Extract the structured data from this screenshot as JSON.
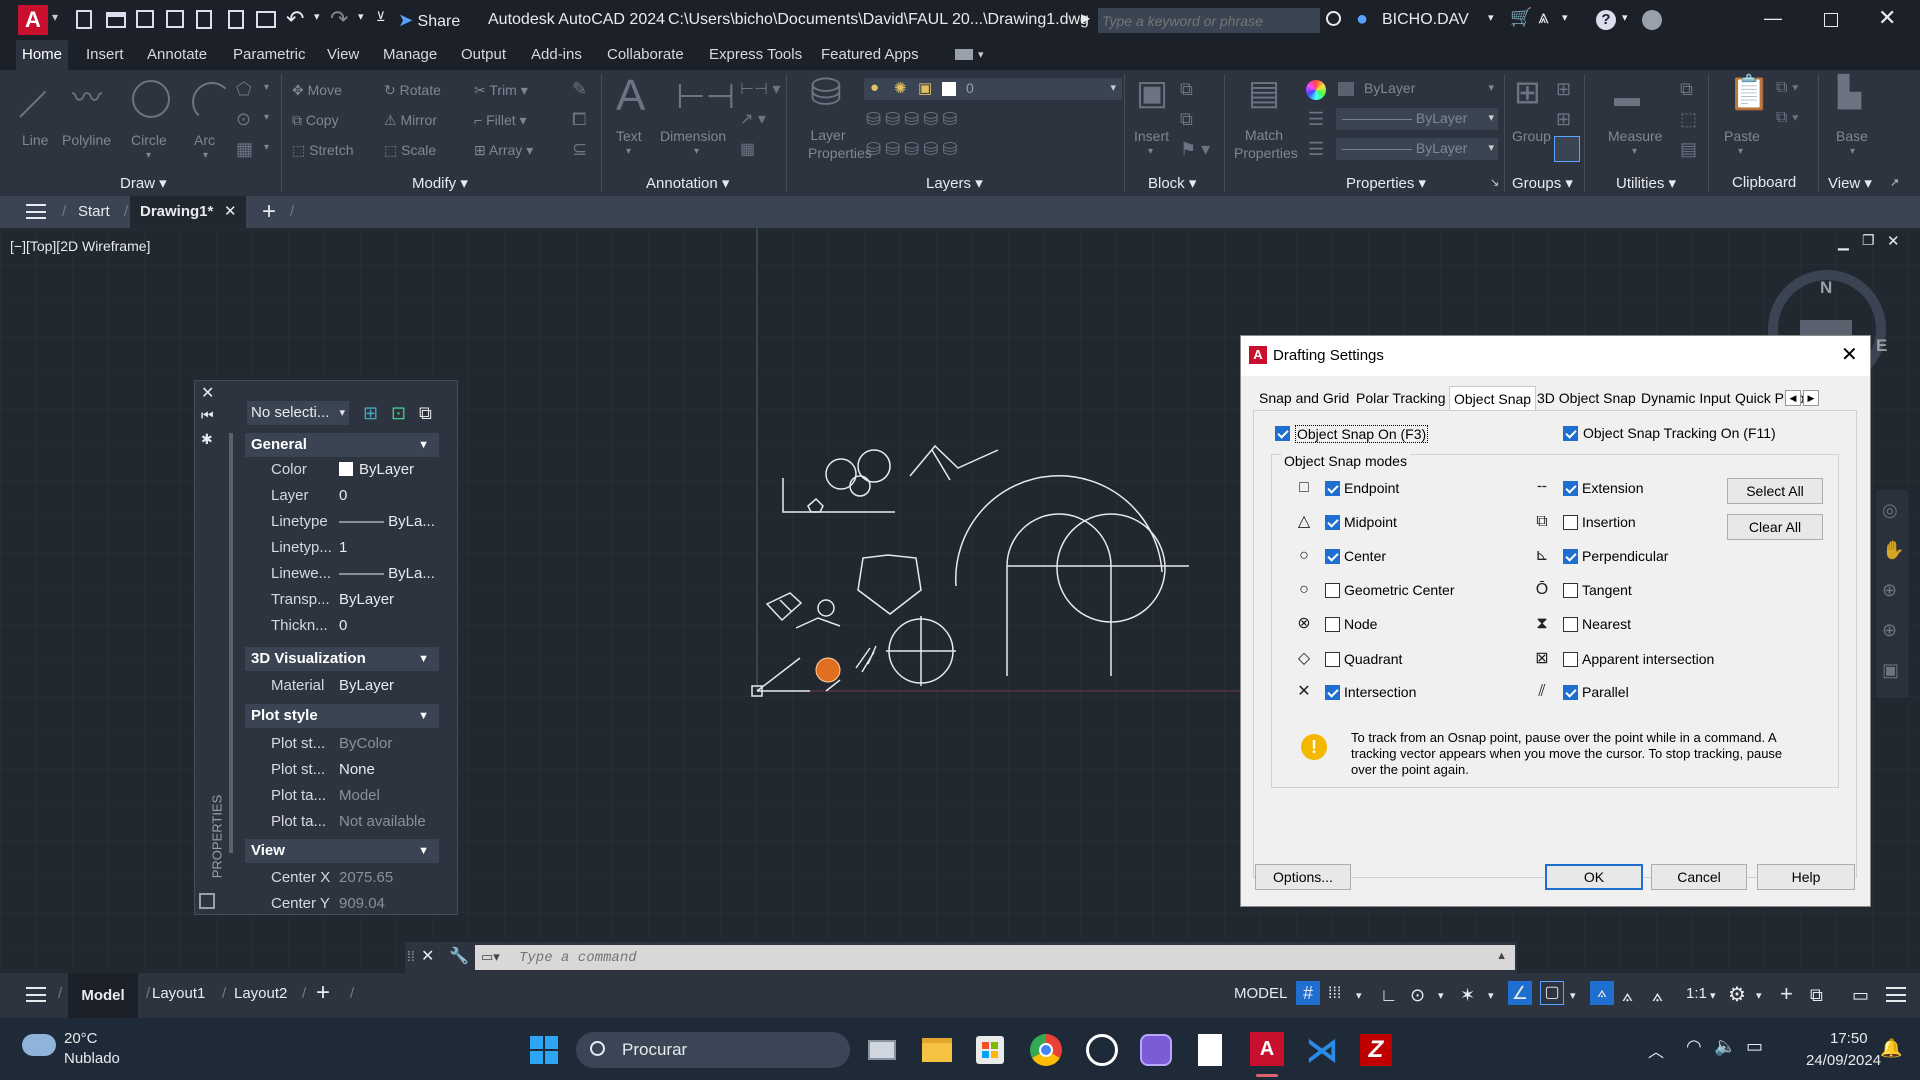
{
  "titlebar": {
    "app_title": "Autodesk AutoCAD 2024",
    "file_path": "C:\\Users\\bicho\\Documents\\David\\FAUL 20...\\Drawing1.dwg",
    "share_label": "Share",
    "search_placeholder": "Type a keyword or phrase",
    "user_name": "BICHO.DAV",
    "app_logo": "A"
  },
  "ribbon_tabs": [
    "Home",
    "Insert",
    "Annotate",
    "Parametric",
    "View",
    "Manage",
    "Output",
    "Add-ins",
    "Collaborate",
    "Express Tools",
    "Featured Apps"
  ],
  "ribbon": {
    "draw": {
      "title": "Draw",
      "tools": [
        "Line",
        "Polyline",
        "Circle",
        "Arc"
      ]
    },
    "modify": {
      "title": "Modify",
      "row1": [
        "Move",
        "Rotate",
        "Trim"
      ],
      "row2": [
        "Copy",
        "Mirror",
        "Fillet"
      ],
      "row3": [
        "Stretch",
        "Scale",
        "Array"
      ]
    },
    "annotation": {
      "title": "Annotation",
      "tools": [
        "Text",
        "Dimension"
      ]
    },
    "layers": {
      "title": "Layers",
      "tool": "Layer Properties",
      "layer_value": "0"
    },
    "block": {
      "title": "Block",
      "tool": "Insert"
    },
    "properties": {
      "title": "Properties",
      "tool": "Match Properties",
      "color": "ByLayer",
      "linetype": "ByLayer",
      "lineweight": "ByLayer"
    },
    "groups": {
      "title": "Groups",
      "tool": "Group"
    },
    "utilities": {
      "title": "Utilities",
      "tool": "Measure"
    },
    "clipboard": {
      "title": "Clipboard",
      "tool": "Paste"
    },
    "view": {
      "title": "View",
      "tool": "Base"
    }
  },
  "filetabs": {
    "start": "Start",
    "drawing": "Drawing1*"
  },
  "viewport_label": "[−][Top][2D Wireframe]",
  "viewcube": {
    "north": "N",
    "east": "E"
  },
  "properties_palette": {
    "selection": "No selecti...",
    "side_label": "PROPERTIES",
    "groups": {
      "general": "General",
      "visualization": "3D Visualization",
      "plot_style": "Plot style",
      "view": "View"
    },
    "general_rows": [
      {
        "k": "Color",
        "v": "ByLayer"
      },
      {
        "k": "Layer",
        "v": "0"
      },
      {
        "k": "Linetype",
        "v": "——— ByLa..."
      },
      {
        "k": "Linetyp...",
        "v": "1"
      },
      {
        "k": "Linewe...",
        "v": "——— ByLa..."
      },
      {
        "k": "Transp...",
        "v": "ByLayer"
      },
      {
        "k": "Thickn...",
        "v": "0"
      }
    ],
    "viz_rows": [
      {
        "k": "Material",
        "v": "ByLayer"
      }
    ],
    "plot_rows": [
      {
        "k": "Plot st...",
        "v": "ByColor"
      },
      {
        "k": "Plot st...",
        "v": "None"
      },
      {
        "k": "Plot ta...",
        "v": "Model"
      },
      {
        "k": "Plot ta...",
        "v": "Not available"
      }
    ],
    "view_rows": [
      {
        "k": "Center X",
        "v": "2075.65"
      },
      {
        "k": "Center Y",
        "v": "909.04"
      }
    ]
  },
  "dialog": {
    "title": "Drafting Settings",
    "tabs": [
      "Snap and Grid",
      "Polar Tracking",
      "Object Snap",
      "3D Object Snap",
      "Dynamic Input",
      "Quick Propert"
    ],
    "snap_on": "Object Snap On (F3)",
    "tracking_on": "Object Snap Tracking On (F11)",
    "modes_label": "Object Snap modes",
    "left_modes": [
      {
        "label": "Endpoint",
        "checked": true,
        "icon": "square-icon"
      },
      {
        "label": "Midpoint",
        "checked": true,
        "icon": "triangle-icon"
      },
      {
        "label": "Center",
        "checked": true,
        "icon": "circle-icon"
      },
      {
        "label": "Geometric Center",
        "checked": false,
        "icon": "circle-icon"
      },
      {
        "label": "Node",
        "checked": false,
        "icon": "node-icon"
      },
      {
        "label": "Quadrant",
        "checked": false,
        "icon": "diamond-icon"
      },
      {
        "label": "Intersection",
        "checked": true,
        "icon": "x-icon"
      }
    ],
    "right_modes": [
      {
        "label": "Extension",
        "checked": true,
        "icon": "extension-icon"
      },
      {
        "label": "Insertion",
        "checked": false,
        "icon": "insertion-icon"
      },
      {
        "label": "Perpendicular",
        "checked": true,
        "icon": "perpendicular-icon"
      },
      {
        "label": "Tangent",
        "checked": false,
        "icon": "tangent-icon"
      },
      {
        "label": "Nearest",
        "checked": false,
        "icon": "nearest-icon"
      },
      {
        "label": "Apparent intersection",
        "checked": false,
        "icon": "apparent-intersection-icon"
      },
      {
        "label": "Parallel",
        "checked": true,
        "icon": "parallel-icon"
      }
    ],
    "select_all": "Select All",
    "clear_all": "Clear All",
    "info": "To track from an Osnap point, pause over the point while in a command.  A tracking vector appears when you move the cursor.  To stop tracking, pause over the point again.",
    "options": "Options...",
    "ok": "OK",
    "cancel": "Cancel",
    "help": "Help"
  },
  "command_line": {
    "placeholder": "Type a command"
  },
  "layout_tabs": [
    "Model",
    "Layout1",
    "Layout2"
  ],
  "statusbar": {
    "mode": "MODEL",
    "scale": "1:1"
  },
  "taskbar": {
    "weather_temp": "20°C",
    "weather_desc": "Nublado",
    "search_label": "Procurar",
    "time": "17:50",
    "date": "24/09/2024"
  },
  "colors": {
    "accent": "#1f6fd0",
    "autocad_red": "#c8102e",
    "canvas": "#212830"
  }
}
